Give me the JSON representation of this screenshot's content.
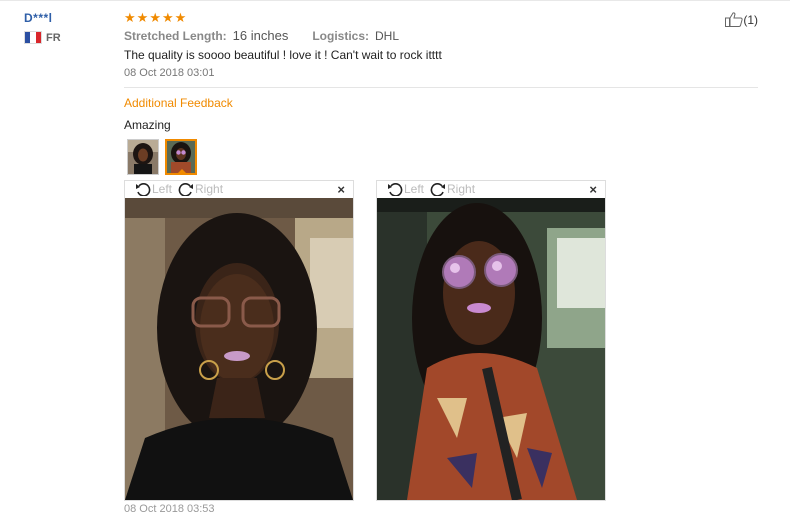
{
  "user": {
    "name": "D***l",
    "country": "FR"
  },
  "review": {
    "rating": 5,
    "stretched_length_label": "Stretched Length:",
    "stretched_length_value": "16 inches",
    "logistics_label": "Logistics:",
    "logistics_value": "DHL",
    "text": "The quality is soooo beautiful ! love it ! Can't wait to rock itttt",
    "date": "08 Oct 2018 03:01"
  },
  "like": {
    "count": "(1)"
  },
  "additional_feedback": {
    "title": "Additional Feedback",
    "text": "Amazing",
    "date": "08 Oct 2018 03:53"
  },
  "viewer": {
    "rotate_left": "Left",
    "rotate_right": "Right",
    "close": "×"
  },
  "colors": {
    "accent": "#f08a00",
    "link": "#2f5fa8"
  },
  "icons": [
    "flag-fr-icon",
    "star-icon",
    "thumbs-up-icon",
    "rotate-left-icon",
    "rotate-right-icon",
    "close-icon"
  ]
}
